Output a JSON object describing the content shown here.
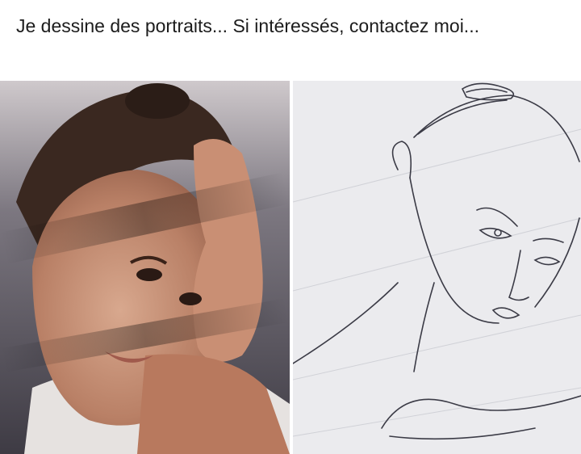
{
  "post": {
    "caption": "Je dessine des portraits... Si intéressés, contactez moi..."
  },
  "images": {
    "left": {
      "description_icon": "portrait-photo"
    },
    "right": {
      "description_icon": "pencil-sketch"
    }
  }
}
